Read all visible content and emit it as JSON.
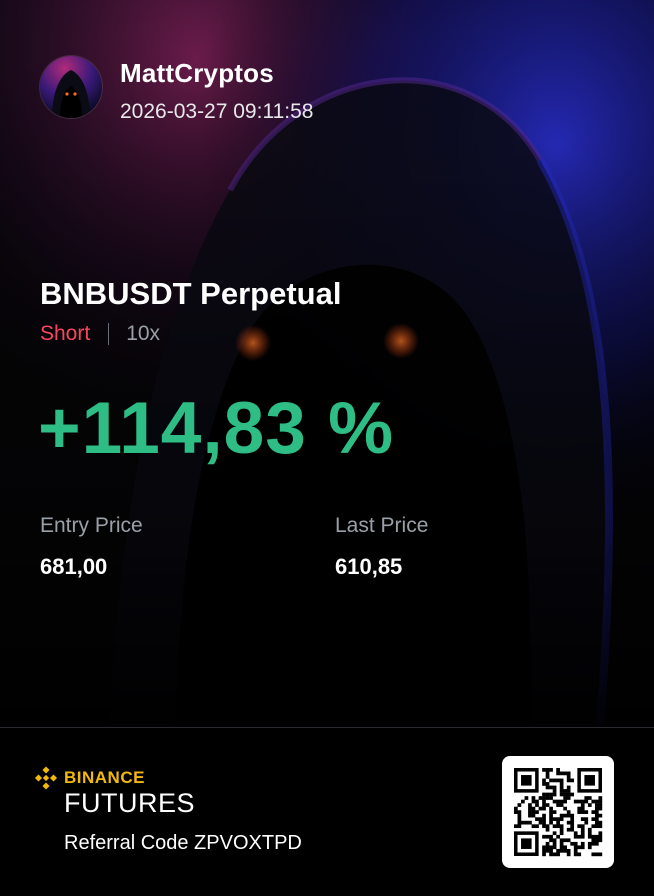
{
  "user": {
    "name": "MattCryptos",
    "timestamp": "2026-03-27 09:11:58"
  },
  "position": {
    "symbol": "BNBUSDT Perpetual",
    "side": "Short",
    "leverage": "10x",
    "pnl_percent": "+114,83 %"
  },
  "prices": {
    "entry_label": "Entry Price",
    "entry_value": "681,00",
    "last_label": "Last Price",
    "last_value": "610,85"
  },
  "footer": {
    "brand_name": "BINANCE",
    "brand_sub": "FUTURES",
    "referral": "Referral Code ZPVOXTPD"
  },
  "colors": {
    "short": "#f6465d",
    "profit": "#2ebd85",
    "brand": "#f0b90b",
    "muted": "#9aa0a8"
  },
  "icons": [
    "avatar-hooded-figure",
    "binance-logo-icon",
    "qr-code"
  ]
}
